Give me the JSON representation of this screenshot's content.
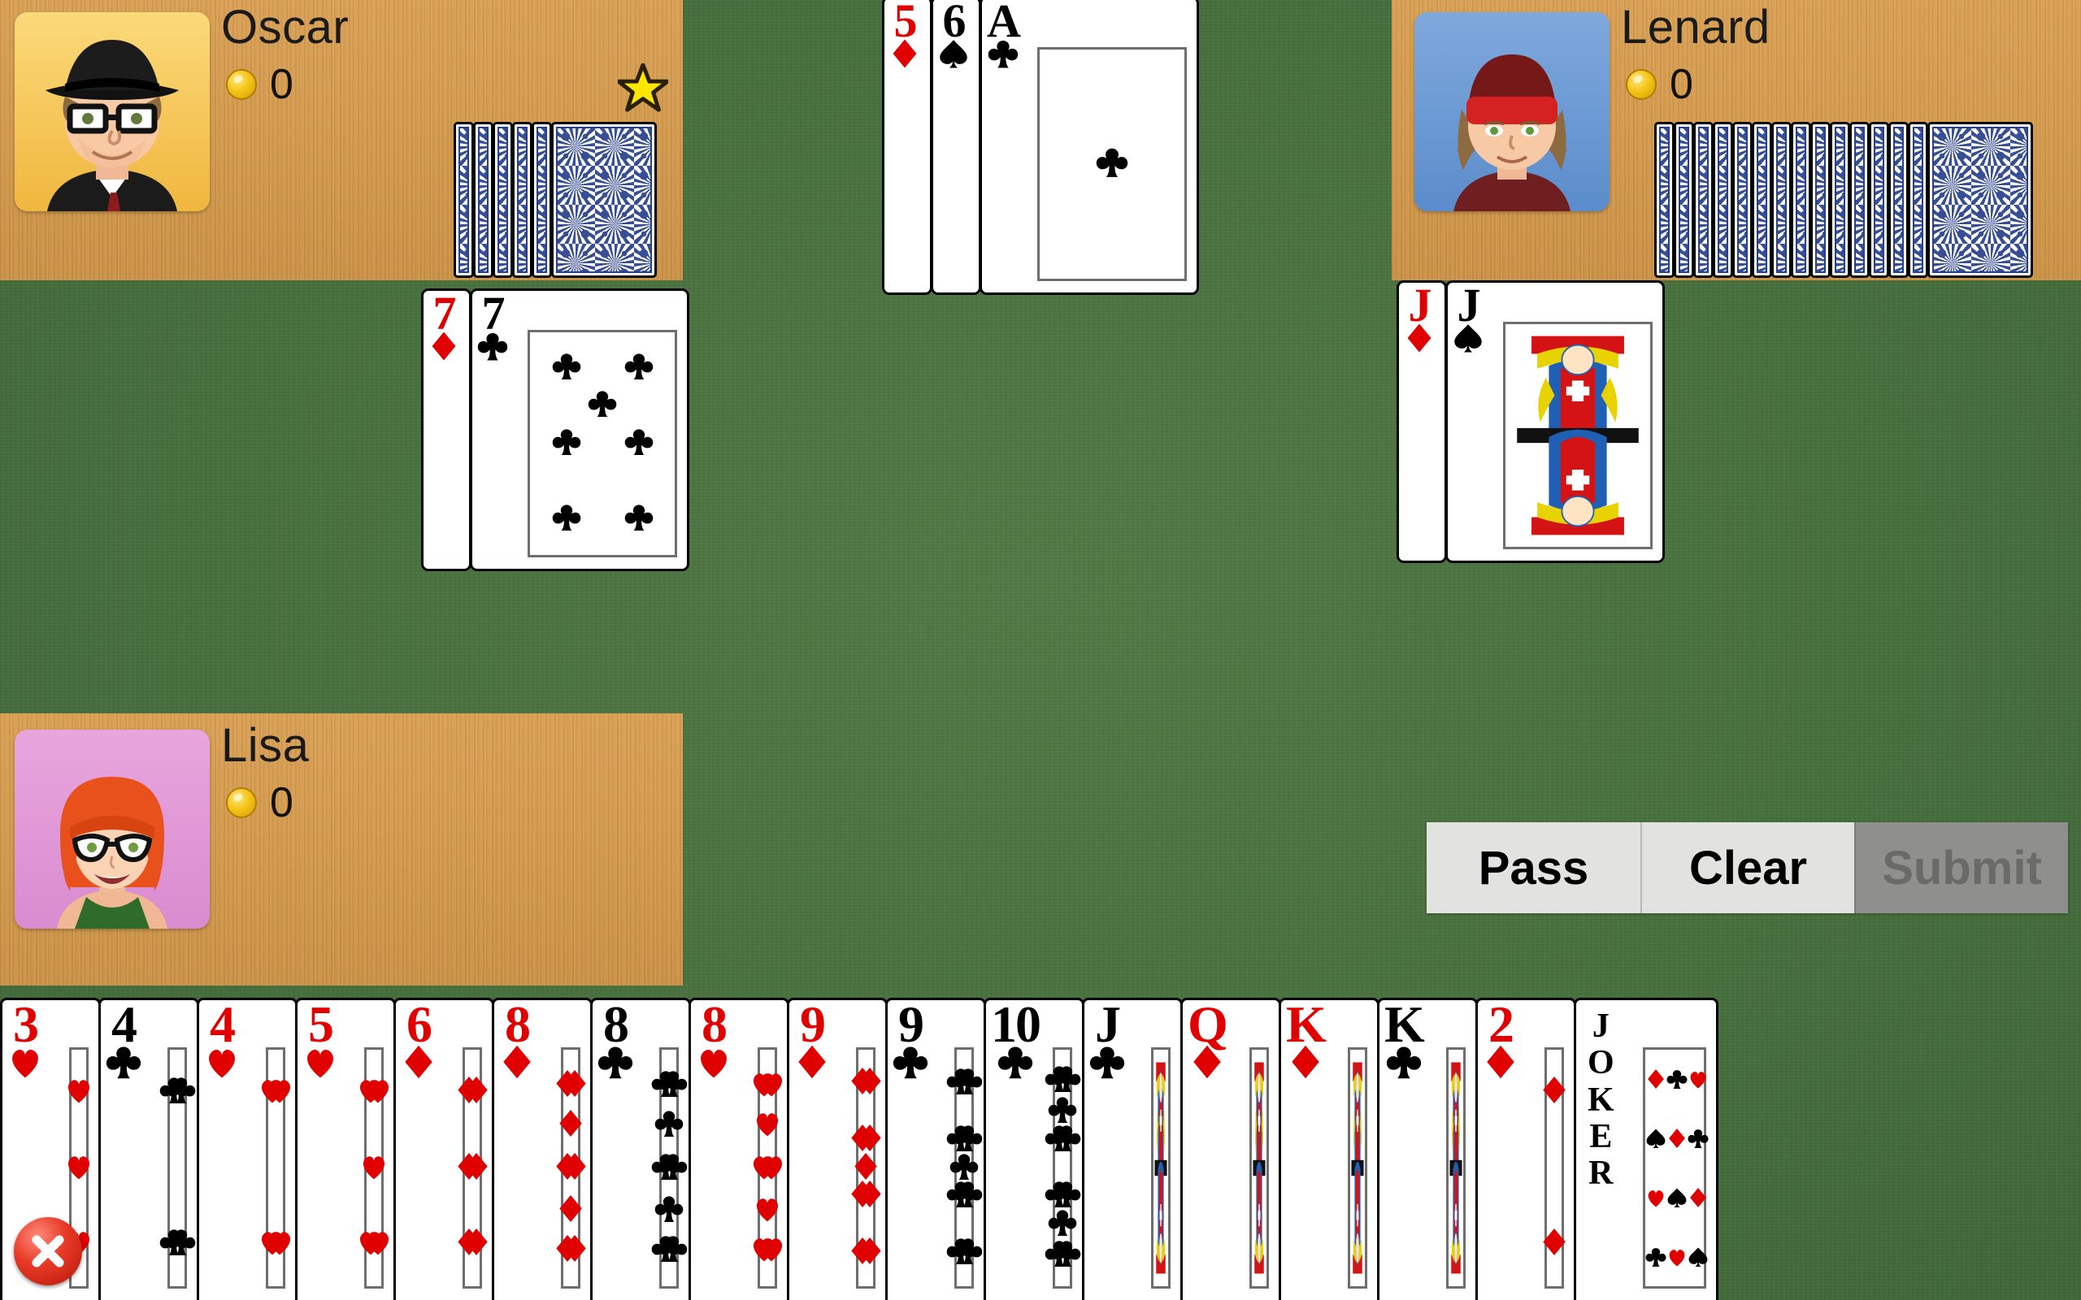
{
  "game": {
    "table_color": "#4a7040",
    "wood_color": "#d49b4e",
    "card_back_color": "#27408b"
  },
  "players": [
    {
      "id": "oscar",
      "name": "Oscar",
      "coins": "0",
      "card_count": 6,
      "is_turn": true,
      "turn_marker": "star-icon"
    },
    {
      "id": "lenard",
      "name": "Lenard",
      "coins": "0",
      "card_count": 15,
      "is_turn": false,
      "turn_marker": ""
    },
    {
      "id": "lisa",
      "name": "Lisa",
      "coins": "0",
      "card_count": 0,
      "is_turn": false,
      "turn_marker": ""
    }
  ],
  "melds": {
    "left": {
      "cards": [
        {
          "rank": "7",
          "suit": "♦",
          "color": "red"
        },
        {
          "rank": "7",
          "suit": "♣",
          "color": "black",
          "pips": 7
        }
      ]
    },
    "right": {
      "cards": [
        {
          "rank": "J",
          "suit": "♦",
          "color": "red"
        },
        {
          "rank": "J",
          "suit": "♠",
          "color": "black",
          "court": "jack-spades"
        }
      ]
    }
  },
  "center_pile": {
    "cards": [
      {
        "rank": "5",
        "suit": "♦",
        "color": "red"
      },
      {
        "rank": "6",
        "suit": "♠",
        "color": "black"
      },
      {
        "rank": "A",
        "suit": "♣",
        "color": "black",
        "pips": 1
      }
    ]
  },
  "actions": {
    "pass_label": "Pass",
    "clear_label": "Clear",
    "submit_label": "Submit",
    "pass_enabled": true,
    "clear_enabled": true,
    "submit_enabled": false
  },
  "hand": {
    "selected_index": 0,
    "selected_badge": "close-x-icon",
    "cards": [
      {
        "rank": "3",
        "suit": "♥",
        "color": "red",
        "pips": 3,
        "label": "3 of Hearts"
      },
      {
        "rank": "4",
        "suit": "♣",
        "color": "black",
        "pips": 4,
        "label": "4 of Clubs"
      },
      {
        "rank": "4",
        "suit": "♥",
        "color": "red",
        "pips": 4,
        "label": "4 of Hearts"
      },
      {
        "rank": "5",
        "suit": "♥",
        "color": "red",
        "pips": 5,
        "label": "5 of Hearts"
      },
      {
        "rank": "6",
        "suit": "♦",
        "color": "red",
        "pips": 6,
        "label": "6 of Diamonds"
      },
      {
        "rank": "8",
        "suit": "♦",
        "color": "red",
        "pips": 8,
        "label": "8 of Diamonds"
      },
      {
        "rank": "8",
        "suit": "♣",
        "color": "black",
        "pips": 8,
        "label": "8 of Clubs"
      },
      {
        "rank": "8",
        "suit": "♥",
        "color": "red",
        "pips": 8,
        "label": "8 of Hearts"
      },
      {
        "rank": "9",
        "suit": "♦",
        "color": "red",
        "pips": 9,
        "label": "9 of Diamonds"
      },
      {
        "rank": "9",
        "suit": "♣",
        "color": "black",
        "pips": 9,
        "label": "9 of Clubs"
      },
      {
        "rank": "10",
        "suit": "♣",
        "color": "black",
        "pips": 10,
        "label": "10 of Clubs"
      },
      {
        "rank": "J",
        "suit": "♣",
        "color": "black",
        "court": "jack-clubs",
        "label": "Jack of Clubs"
      },
      {
        "rank": "Q",
        "suit": "♦",
        "color": "red",
        "court": "queen-diamonds",
        "label": "Queen of Diamonds"
      },
      {
        "rank": "K",
        "suit": "♦",
        "color": "red",
        "court": "king-diamonds",
        "label": "King of Diamonds"
      },
      {
        "rank": "K",
        "suit": "♣",
        "color": "black",
        "court": "king-clubs",
        "label": "King of Clubs"
      },
      {
        "rank": "2",
        "suit": "♦",
        "color": "red",
        "pips": 2,
        "label": "2 of Diamonds"
      },
      {
        "rank": "JOKER",
        "suit": "",
        "color": "black",
        "joker": true,
        "label": "Joker"
      }
    ]
  }
}
